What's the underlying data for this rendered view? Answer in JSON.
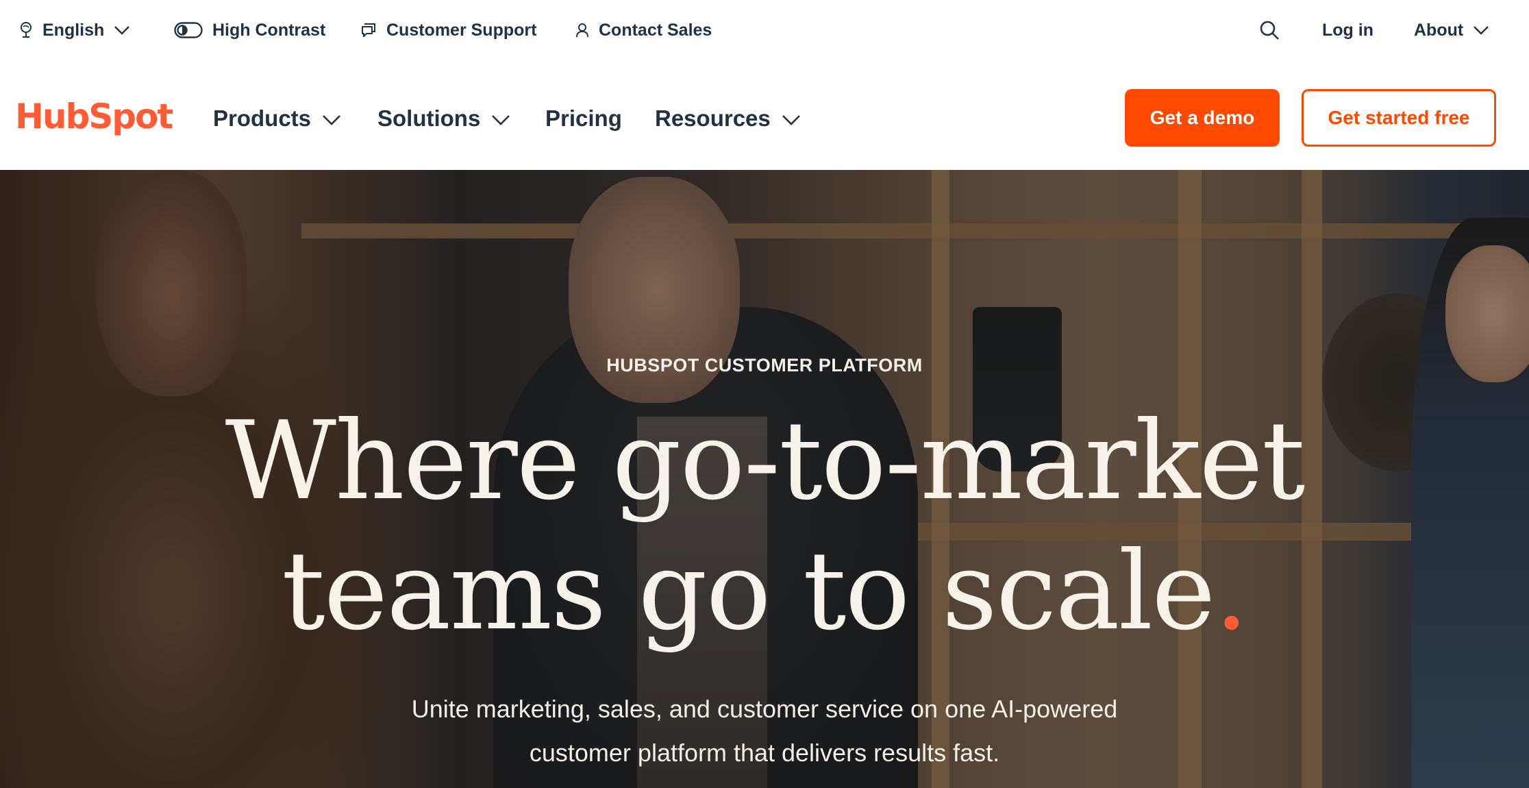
{
  "utility": {
    "language": "English",
    "high_contrast": "High Contrast",
    "support": "Customer Support",
    "sales": "Contact Sales",
    "login": "Log in",
    "about": "About"
  },
  "nav": {
    "logo": "HubSpot",
    "products": "Products",
    "solutions": "Solutions",
    "pricing": "Pricing",
    "resources": "Resources",
    "cta_demo": "Get a demo",
    "cta_free": "Get started free"
  },
  "hero": {
    "eyebrow": "HUBSPOT CUSTOMER PLATFORM",
    "headline_line1": "Where go-to-market",
    "headline_line2": "teams go to scale",
    "headline_dot": ".",
    "subhead_line1": "Unite marketing, sales, and customer service on one AI-powered",
    "subhead_line2": "customer platform that delivers results fast."
  },
  "colors": {
    "brand_orange": "#ff4800",
    "logo_orange": "#ff5c35",
    "text_dark": "#213343",
    "hero_text": "#f8f3ea"
  },
  "icons": {
    "language": "globe-icon",
    "contrast": "toggle-icon",
    "support": "chat-icon",
    "sales": "person-icon",
    "search": "search-icon",
    "dropdown": "chevron-down-icon"
  }
}
